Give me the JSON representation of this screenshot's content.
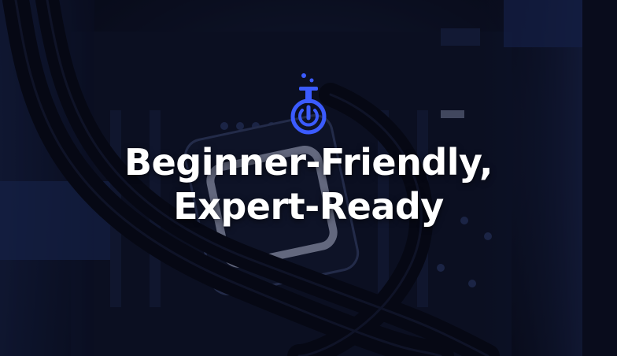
{
  "hero": {
    "headline_line1": "Beginner-Friendly,",
    "headline_line2": "Expert-Ready"
  },
  "logo": {
    "icon": "power-flask-icon",
    "accent": "#3b5bff"
  },
  "background": {
    "subject": "pc-motherboard-cpu-cooler-photo",
    "tint": "#0b1020"
  }
}
